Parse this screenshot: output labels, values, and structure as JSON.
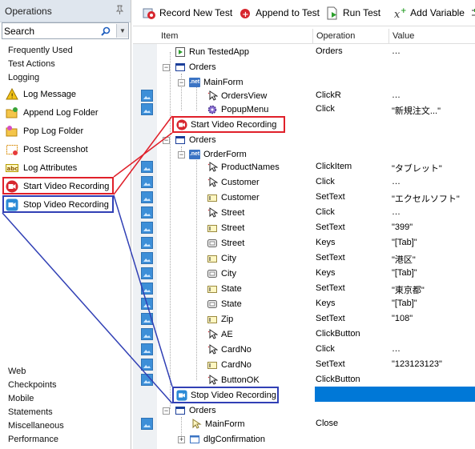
{
  "ops_panel": {
    "title": "Operations",
    "search_value": "Search",
    "groups_top": [
      "Frequently Used",
      "Test Actions",
      "Logging"
    ],
    "items": [
      {
        "label": "Log Message",
        "icon": "log-message-icon"
      },
      {
        "label": "Append Log Folder",
        "icon": "append-folder-icon"
      },
      {
        "label": "Pop Log Folder",
        "icon": "pop-folder-icon"
      },
      {
        "label": "Post Screenshot",
        "icon": "screenshot-icon"
      },
      {
        "label": "Log Attributes",
        "icon": "attributes-icon"
      },
      {
        "label": "Start Video Recording",
        "icon": "start-video-icon"
      },
      {
        "label": "Stop Video Recording",
        "icon": "stop-video-icon"
      }
    ],
    "groups_bottom": [
      "Web",
      "Checkpoints",
      "Mobile",
      "Statements",
      "Miscellaneous",
      "Performance"
    ]
  },
  "toolbar": {
    "record": "Record New Test",
    "append": "Append to Test",
    "run": "Run Test",
    "addvar": "Add Variable"
  },
  "grid": {
    "headers": {
      "item": "Item",
      "operation": "Operation",
      "value": "Value"
    },
    "rows": [
      {
        "item": "Run TestedApp",
        "op": "Orders",
        "val": "…"
      },
      {
        "item": "Orders",
        "op": "",
        "val": ""
      },
      {
        "item": "MainForm",
        "op": "",
        "val": ""
      },
      {
        "item": "OrdersView",
        "op": "ClickR",
        "val": "…"
      },
      {
        "item": "PopupMenu",
        "op": "Click",
        "val": "\"新規注文...\""
      },
      {
        "item": "Start Video Recording",
        "op": "",
        "val": ""
      },
      {
        "item": "Orders",
        "op": "",
        "val": ""
      },
      {
        "item": "OrderForm",
        "op": "",
        "val": ""
      },
      {
        "item": "ProductNames",
        "op": "ClickItem",
        "val": "\"タブレット\""
      },
      {
        "item": "Customer",
        "op": "Click",
        "val": "…"
      },
      {
        "item": "Customer",
        "op": "SetText",
        "val": "\"エクセルソフト\""
      },
      {
        "item": "Street",
        "op": "Click",
        "val": "…"
      },
      {
        "item": "Street",
        "op": "SetText",
        "val": "\"399\""
      },
      {
        "item": "Street",
        "op": "Keys",
        "val": "\"[Tab]\""
      },
      {
        "item": "City",
        "op": "SetText",
        "val": "\"港区\""
      },
      {
        "item": "City",
        "op": "Keys",
        "val": "\"[Tab]\""
      },
      {
        "item": "State",
        "op": "SetText",
        "val": "\"東京都\""
      },
      {
        "item": "State",
        "op": "Keys",
        "val": "\"[Tab]\""
      },
      {
        "item": "Zip",
        "op": "SetText",
        "val": "\"108\""
      },
      {
        "item": "AE",
        "op": "ClickButton",
        "val": ""
      },
      {
        "item": "CardNo",
        "op": "Click",
        "val": "…"
      },
      {
        "item": "CardNo",
        "op": "SetText",
        "val": "\"123123123\""
      },
      {
        "item": "ButtonOK",
        "op": "ClickButton",
        "val": ""
      },
      {
        "item": "Stop Video Recording",
        "op": "",
        "val": ""
      },
      {
        "item": "Orders",
        "op": "",
        "val": ""
      },
      {
        "item": "MainForm",
        "op": "Close",
        "val": ""
      },
      {
        "item": "dlgConfirmation",
        "op": "",
        "val": ""
      }
    ]
  },
  "colors": {
    "highlight_red": "#e0202a",
    "highlight_blue": "#3140b5",
    "selection": "#0078d7"
  }
}
